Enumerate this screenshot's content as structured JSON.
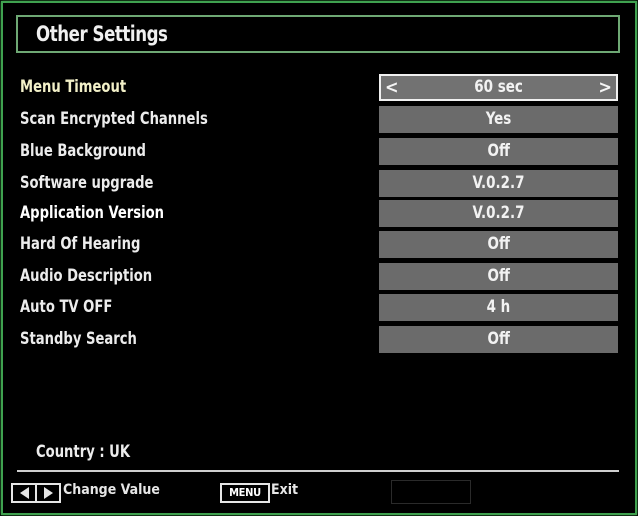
{
  "header": {
    "title": "Other Settings"
  },
  "settings": [
    {
      "label": "Menu Timeout",
      "value": "60 sec",
      "active": true
    },
    {
      "label": "Scan Encrypted Channels",
      "value": "Yes"
    },
    {
      "label": "Blue Background",
      "value": "Off"
    },
    {
      "label": "Software upgrade",
      "value": "V.0.2.7"
    },
    {
      "label": "Application Version",
      "value": "V.0.2.7"
    },
    {
      "label": "Hard Of Hearing",
      "value": "Off"
    },
    {
      "label": "Audio Description",
      "value": "Off"
    },
    {
      "label": "Auto TV OFF",
      "value": "4 h"
    },
    {
      "label": "Standby Search",
      "value": "Off"
    }
  ],
  "icons": {
    "prev": "chevron-left-icon",
    "next": "chevron-right-icon"
  },
  "arrows": {
    "left": "<",
    "right": ">"
  },
  "country": "Country : UK",
  "footer": {
    "change_value_label": "Change Value",
    "menu_key_label": "MENU",
    "exit_label": "Exit"
  },
  "colors": {
    "frame": "#3fa14f",
    "value_bg": "#6b6b6b",
    "active_label": "#f2f0c8"
  }
}
